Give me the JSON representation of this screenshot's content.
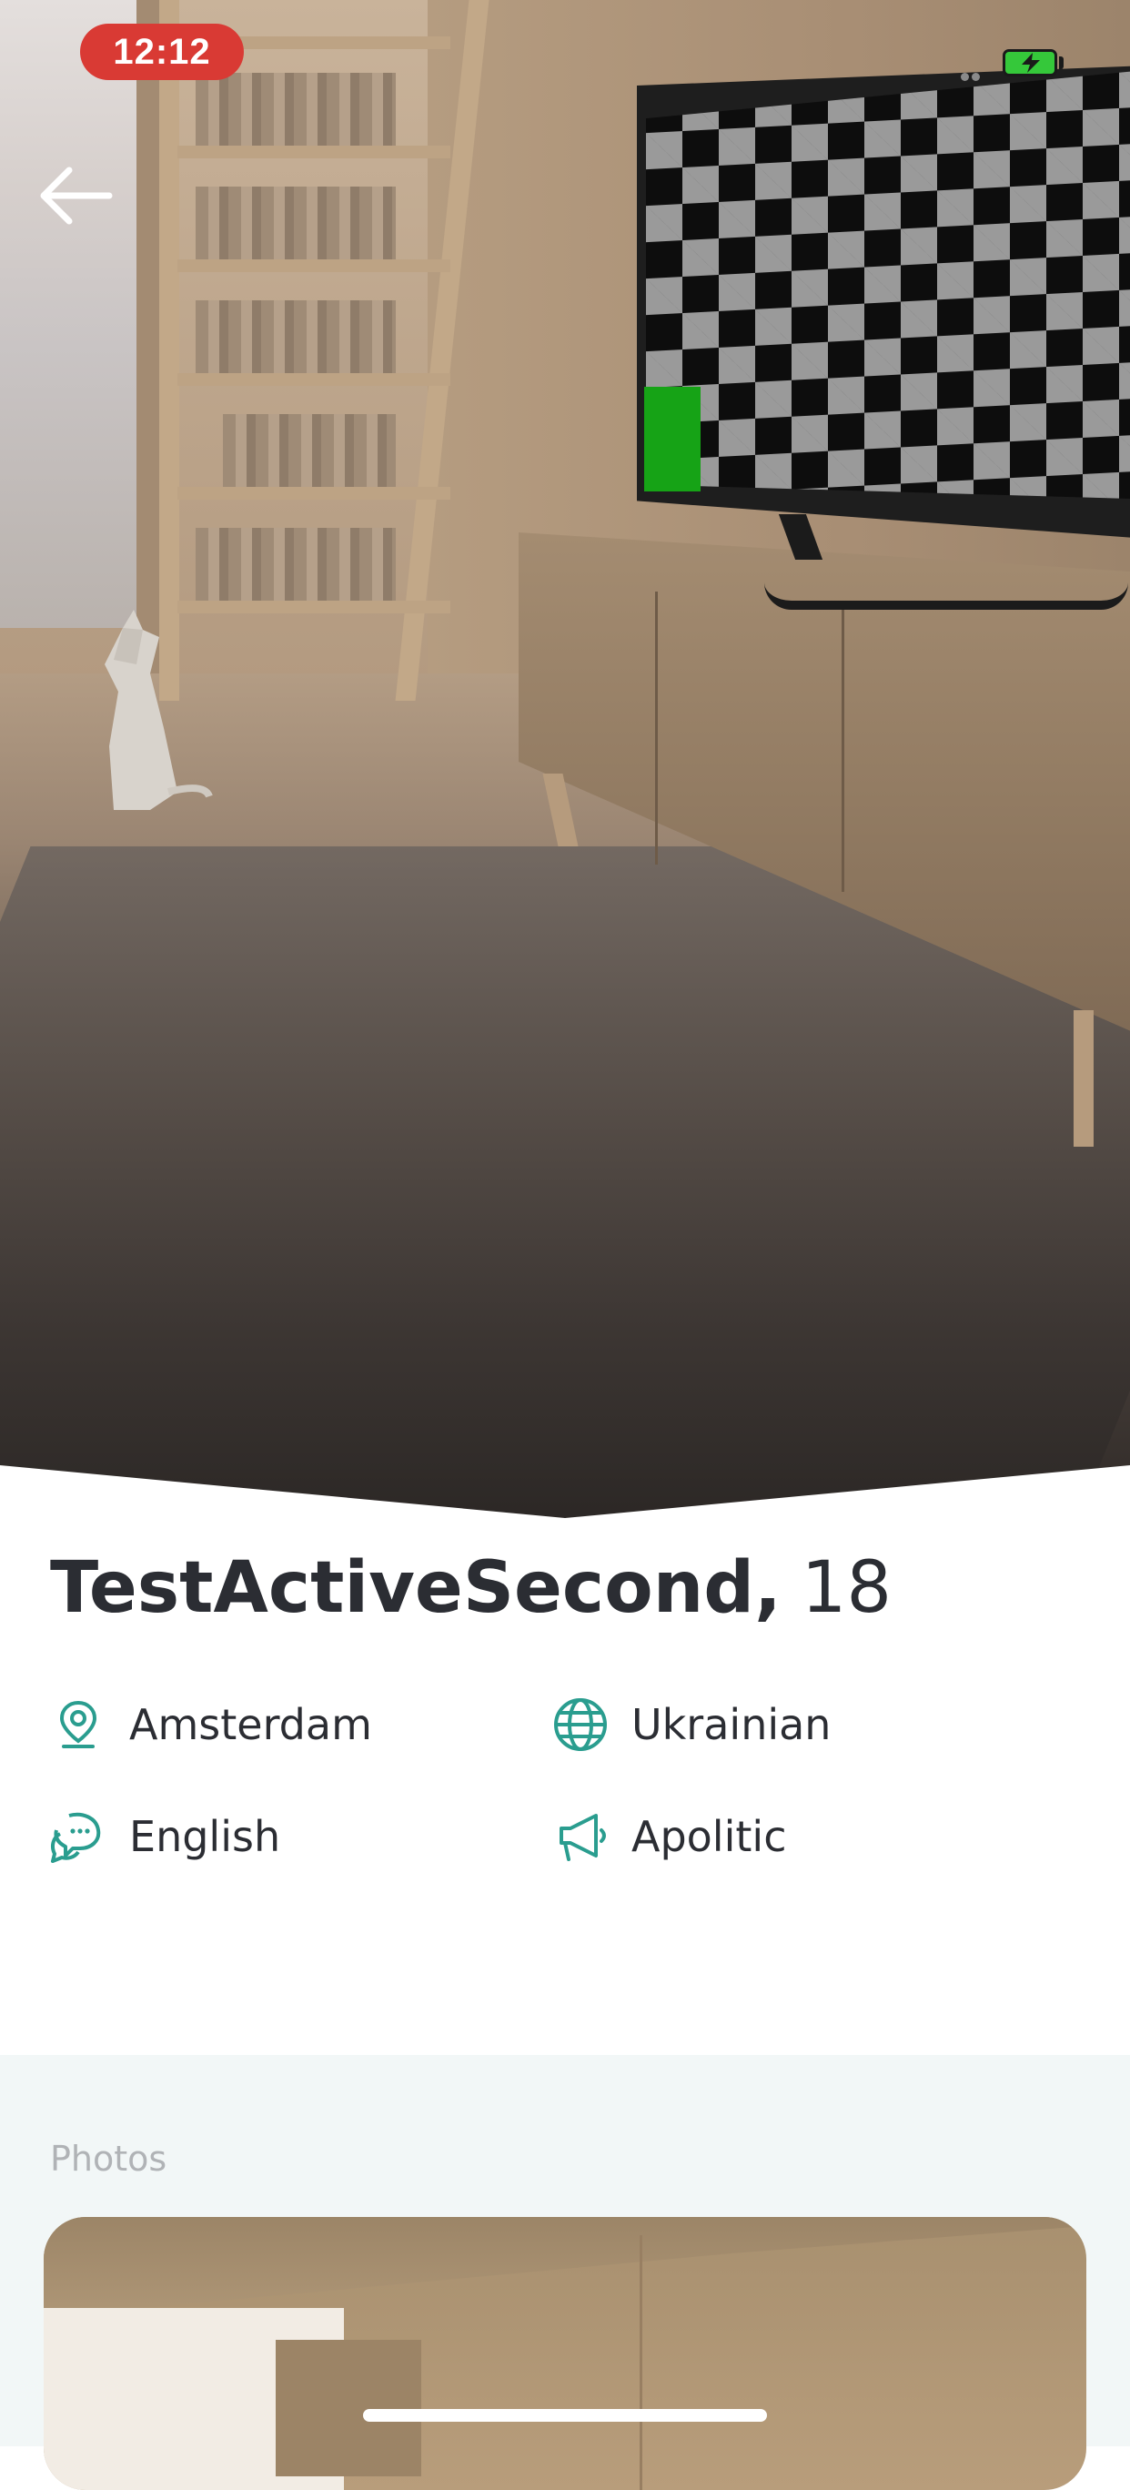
{
  "status_bar": {
    "time": "12:12",
    "time_pill_color": "#d93a34",
    "battery_color": "#35c83a"
  },
  "navigation": {
    "back_icon": "arrow-left-icon"
  },
  "profile": {
    "name": "TestActiveSecond,",
    "age": "18",
    "attributes": {
      "city": {
        "icon": "location-pin-icon",
        "value": "Amsterdam"
      },
      "nationality": {
        "icon": "globe-icon",
        "value": "Ukrainian"
      },
      "language": {
        "icon": "chat-bubbles-icon",
        "value": "English"
      },
      "politics": {
        "icon": "megaphone-icon",
        "value": "Apolitic"
      }
    },
    "icon_color": "#2a9d8f"
  },
  "photos": {
    "label": "Photos",
    "section_background": "#f2f7f7"
  }
}
